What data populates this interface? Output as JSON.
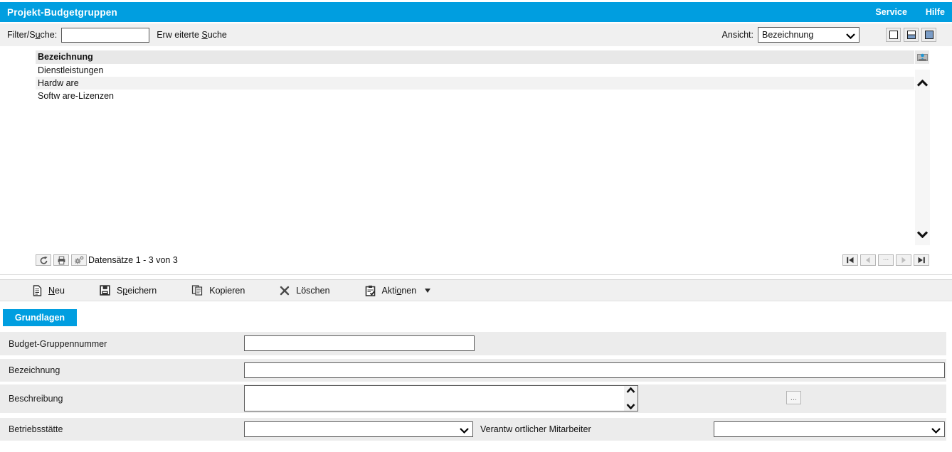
{
  "colors": {
    "brand_blue": "#009ee0",
    "bar_gray": "#f0f0f0",
    "table_header_gray": "#e8e8e8",
    "alt_row_gray": "#f2f2f2",
    "form_row_gray": "#ececec",
    "view_icon_blue": "#7a9cc6"
  },
  "titlebar": {
    "title": "Projekt-Budgetgruppen",
    "menu": [
      {
        "label": "Service"
      },
      {
        "label": "Hilfe"
      }
    ]
  },
  "filterbar": {
    "filter_label": {
      "pre": "Filter/S",
      "accel": "u",
      "post": "che:"
    },
    "filter_value": "",
    "advanced_search": {
      "pre": "Erw eiterte ",
      "accel": "S",
      "post": "uche"
    },
    "view_label": "Ansicht:",
    "view_selected": "Bezeichnung"
  },
  "table": {
    "column_header": "Bezeichnung",
    "rows": [
      "Dienstleistungen",
      "Hardw are",
      "Softw are-Lizenzen"
    ],
    "status_text": "Datensätze 1 - 3 von 3",
    "pagination_ellipsis": "..."
  },
  "toolbar": {
    "neu": {
      "pre": "",
      "accel": "N",
      "post": "eu"
    },
    "speichern": {
      "pre": "S",
      "accel": "p",
      "post": "eichern"
    },
    "kopieren": {
      "label": "Kopieren"
    },
    "loeschen": {
      "label": "Löschen"
    },
    "aktionen": {
      "pre": "Akti",
      "accel": "o",
      "post": "nen"
    }
  },
  "tab": {
    "label": "Grundlagen"
  },
  "form": {
    "budget_gruppennummer": {
      "label": "Budget-Gruppennummer",
      "value": ""
    },
    "bezeichnung": {
      "label": "Bezeichnung",
      "value": ""
    },
    "beschreibung": {
      "label": "Beschreibung",
      "value": ""
    },
    "betriebsstaette": {
      "label": "Betriebsstätte",
      "value": ""
    },
    "verantwortlicher_mitarbeiter": {
      "label": "Verantw ortlicher Mitarbeiter",
      "value": ""
    },
    "more_button_label": "..."
  }
}
